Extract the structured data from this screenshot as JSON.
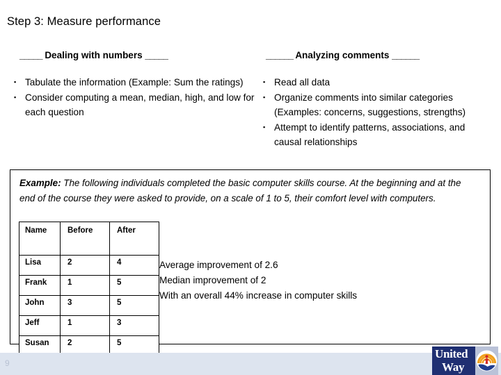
{
  "slide": {
    "title": "Step 3: Measure performance",
    "page_number": "9"
  },
  "columns": {
    "left": {
      "rule_before": "_____",
      "heading": "Dealing with numbers",
      "rule_after": "_____",
      "bullets": [
        "Tabulate the information (Example: Sum the ratings)",
        "Consider computing a mean, median, high, and low for each question"
      ]
    },
    "right": {
      "rule_before": "______",
      "heading": "Analyzing comments",
      "rule_after": "______",
      "bullets": [
        "Read all data",
        "Organize comments into similar categories (Examples: concerns, suggestions, strengths)",
        "Attempt to identify patterns, associations, and causal relationships"
      ]
    }
  },
  "example": {
    "lead_label": "Example:",
    "body": " The following individuals completed the basic computer skills course.  At the beginning and at the end of the course they were asked to provide, on a scale of 1 to 5, their comfort level with computers.",
    "table": {
      "headers": [
        "Name",
        "Before",
        "After"
      ],
      "rows": [
        [
          "Lisa",
          "2",
          "4"
        ],
        [
          "Frank",
          "1",
          "5"
        ],
        [
          "John",
          "3",
          "5"
        ],
        [
          "Jeff",
          "1",
          "3"
        ],
        [
          "Susan",
          "2",
          "5"
        ]
      ]
    },
    "summary": [
      "Average improvement of 2.6",
      "Median improvement of 2",
      "With an overall 44% increase in computer skills"
    ]
  },
  "logo": {
    "line1": "United",
    "line2": "Way",
    "icon": "united-way-rainbow-hand-person"
  },
  "colors": {
    "footer_band": "#dde4ef",
    "logo_navy": "#1f2f72",
    "logo_panel": "#b9c2d8",
    "rainbow_orange": "#f0a01e",
    "figure_red": "#d12b27",
    "hand_blue": "#1f3d8f",
    "page_number": "#b9c2d3"
  },
  "bullet_glyph": "▪"
}
